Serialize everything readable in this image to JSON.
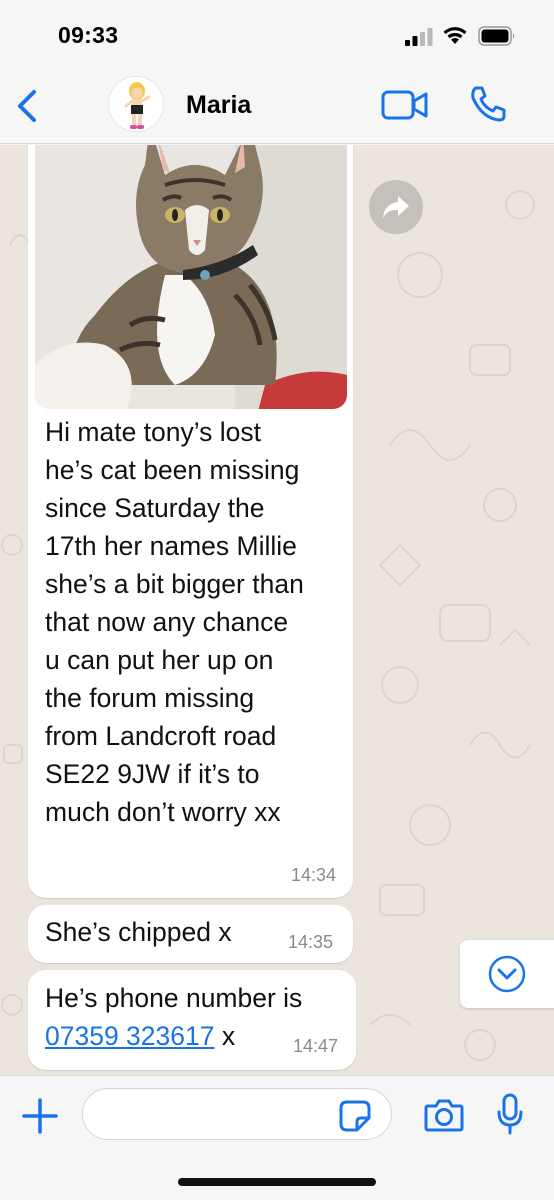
{
  "status_bar": {
    "time": "09:33"
  },
  "header": {
    "contact_name": "Maria",
    "icons": [
      "back-chevron-icon",
      "avatar",
      "video-camera-icon",
      "phone-icon"
    ]
  },
  "messages": [
    {
      "has_photo": true,
      "photo_subject": "cat-photo",
      "text": "Hi mate tony’s lost\nhe’s cat been missing\nsince Saturday the\n17th her names Millie\nshe’s a bit bigger than\nthat now any chance\nu can put her up on\nthe forum missing\nfrom Landcroft road\nSE22 9JW if it’s to\nmuch don’t worry xx",
      "time": "14:34"
    },
    {
      "text": "She’s chipped x",
      "time": "14:35"
    },
    {
      "text_before_link": "He’s phone number is",
      "link": "07359 323617",
      "text_after_link": " x",
      "time": "14:47"
    }
  ],
  "input_bar": {
    "placeholder": "",
    "icons": [
      "plus-icon",
      "sticker-icon",
      "camera-icon",
      "microphone-icon"
    ]
  },
  "colors": {
    "accent": "#1a73e8",
    "chat_background": "#ebe5dd",
    "bubble": "#ffffff",
    "bar_background": "#f6f6f6"
  }
}
